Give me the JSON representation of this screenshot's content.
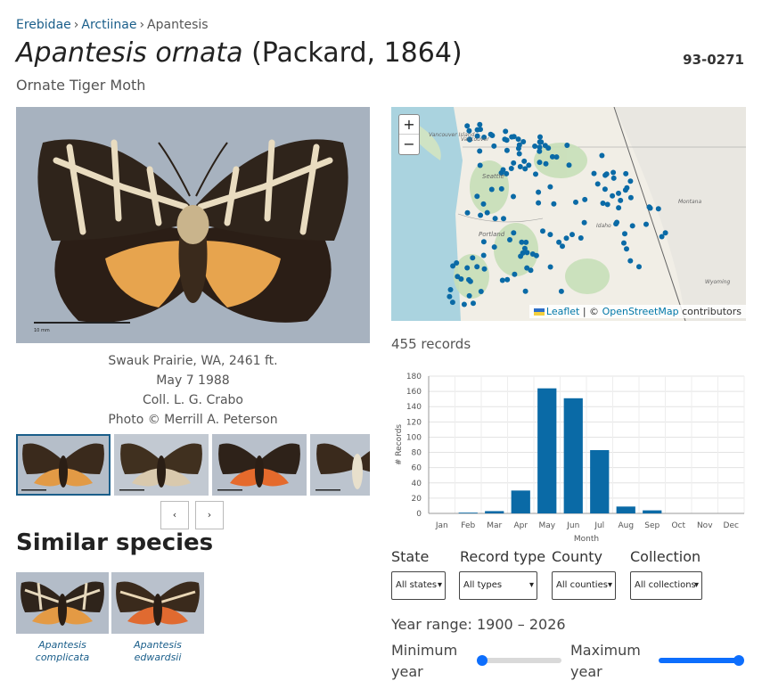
{
  "breadcrumb": {
    "family": "Erebidae",
    "subfamily": "Arctiinae",
    "genus": "Apantesis",
    "sep": "›"
  },
  "title": {
    "genus_species": "Apantesis ornata",
    "author": "(Packard, 1864)"
  },
  "hodges_number": "93-0271",
  "common_name": "Ornate Tiger Moth",
  "photo": {
    "scale_label": "10 mm",
    "caption_lines": [
      "Swauk Prairie, WA, 2461 ft.",
      "May 7 1988",
      "Coll. L. G. Crabo",
      "Photo © Merrill A. Peterson"
    ]
  },
  "pager": {
    "prev": "‹",
    "next": "›"
  },
  "similar": {
    "heading": "Similar species",
    "items": [
      {
        "line1": "Apantesis",
        "line2": "complicata"
      },
      {
        "line1": "Apantesis",
        "line2": "edwardsii"
      }
    ]
  },
  "map": {
    "zoom_in": "+",
    "zoom_out": "−",
    "attribution_leaflet": "Leaflet",
    "attribution_sep": "| ©",
    "attribution_osm": "OpenStreetMap",
    "attribution_suffix": "contributors",
    "place_labels": [
      "Vancouver Island",
      "Vancouver",
      "Seattle",
      "Portland",
      "Idaho",
      "Montana",
      "Wyoming"
    ]
  },
  "record_count": "455 records",
  "chart_data": {
    "type": "bar",
    "categories": [
      "Jan",
      "Feb",
      "Mar",
      "Apr",
      "May",
      "Jun",
      "Jul",
      "Aug",
      "Sep",
      "Oct",
      "Nov",
      "Dec"
    ],
    "values": [
      0,
      1,
      3,
      30,
      164,
      151,
      83,
      9,
      4,
      0,
      0,
      0
    ],
    "xlabel": "Month",
    "ylabel": "# Records",
    "ylim": [
      0,
      180
    ],
    "yticks": [
      0,
      20,
      40,
      60,
      80,
      100,
      120,
      140,
      160,
      180
    ],
    "bar_color": "#0a6aa6",
    "grid": true
  },
  "filters": {
    "state": {
      "label": "State",
      "value": "All states"
    },
    "record_type": {
      "label": "Record type",
      "value": "All types"
    },
    "county": {
      "label": "County",
      "value": "All counties"
    },
    "collection": {
      "label": "Collection",
      "value": "All collections"
    }
  },
  "year_range": {
    "text": "Year range: 1900 – 2026",
    "min_label": "Minimum year",
    "max_label": "Maximum year"
  },
  "colors": {
    "link": "#1a5e8a",
    "accent": "#0d6efd",
    "map_dot": "#0a6aa6"
  }
}
